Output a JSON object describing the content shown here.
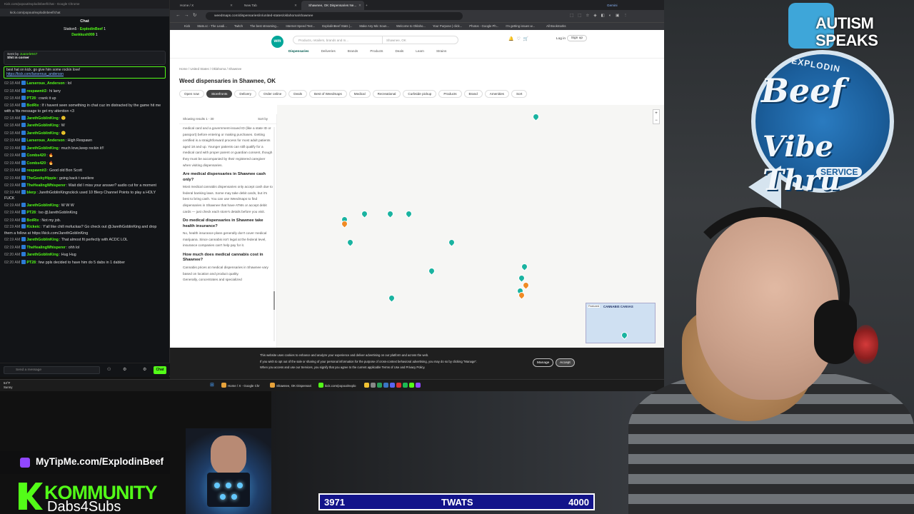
{
  "chat": {
    "window_title": "Kick.com/popout/explodinbeef/chat - Google Chrome",
    "url": "kick.com/popout/explodinbeef/chat",
    "header": "Chat",
    "top_gifters": [
      {
        "name": "Station5",
        "user": "ExplodinBeef",
        "count": "1"
      },
      {
        "name": "Dankkush999",
        "count": "1"
      }
    ],
    "pinned": {
      "by_label": "Sent by",
      "by_user": "Juanele947",
      "text": "Shit in corner"
    },
    "highlight": {
      "text": "best hat on kick. go give him some rockin love!",
      "link": "https://kick.com/larserous_anderson"
    },
    "messages": [
      {
        "time": "02:18 AM",
        "user": "Larserous_Anderson",
        "text": "lol"
      },
      {
        "time": "02:18 AM",
        "user": "respawnit3",
        "text": "hi larry"
      },
      {
        "time": "02:18 AM",
        "user": "PT28",
        "text": "crank it up"
      },
      {
        "time": "02:18 AM",
        "user": "BotRix",
        "text": "If i havent seen something in chat cuz im distracted by the game hit me with a !tts message to get my attention <3"
      },
      {
        "time": "02:18 AM",
        "user": "JarethGoblinKing",
        "text": "🙂"
      },
      {
        "time": "02:18 AM",
        "user": "JarethGoblinKing",
        "text": "W"
      },
      {
        "time": "02:18 AM",
        "user": "JarethGoblinKing",
        "text": "🙂"
      },
      {
        "time": "02:19 AM",
        "user": "Larserous_Anderson",
        "text": "High Respawn"
      },
      {
        "time": "02:19 AM",
        "user": "JarethGoblinKing",
        "text": "much love,keep rockin it!!"
      },
      {
        "time": "02:19 AM",
        "user": "Combs420",
        "text": "🔥"
      },
      {
        "time": "02:19 AM",
        "user": "Combs420",
        "text": "🔥"
      },
      {
        "time": "02:19 AM",
        "user": "respawnit3",
        "text": "Good old Bon Scott"
      },
      {
        "time": "02:19 AM",
        "user": "TheGeekyHippie",
        "text": "going back t seeilere"
      },
      {
        "time": "02:19 AM",
        "user": "TheHealingWhisperer",
        "text": "Wait did I miss your answer? audio cut for a moment"
      },
      {
        "time": "02:19 AM",
        "user": "blerp",
        "text": "JarethGoblinKingnckick used 10 Blerp Channel Points to play a HOLY FUCK"
      },
      {
        "time": "02:19 AM",
        "user": "JarethGoblinKing",
        "text": "W W W"
      },
      {
        "time": "02:19 AM",
        "user": "PT28",
        "text": "lso @JarethGoblinKing"
      },
      {
        "time": "02:19 AM",
        "user": "BotRix",
        "text": "Not my job."
      },
      {
        "time": "02:19 AM",
        "user": "Kickeic",
        "text": "Y'all like chill mofuckas? Go check out @JarethGoblinKing and drop them a follow at https://kick.com/JarethGoblinKing"
      },
      {
        "time": "02:19 AM",
        "user": "JarethGoblinKing",
        "text": "That almost fit perfectly with ACDC LOL"
      },
      {
        "time": "02:19 AM",
        "user": "TheHealingWhisperer",
        "text": "ohh lol"
      },
      {
        "time": "02:20 AM",
        "user": "JarethGoblinKing",
        "text": "Hug Hug"
      },
      {
        "time": "02:20 AM",
        "user": "PT28",
        "text": "few ppls decided to have him do 5 dabs in 1 dabber"
      }
    ],
    "input_placeholder": "Send a message",
    "send_label": "Chat"
  },
  "browser": {
    "tabs": [
      {
        "label": "Home / X"
      },
      {
        "label": "New Tab"
      },
      {
        "label": "Shawnee, OK Dispensaries Ne..."
      }
    ],
    "gemini_label": "Gemini",
    "url": "weedmaps.com/dispensaries/in/united-states/oklahoma/shawnee",
    "bookmarks": [
      "Kick",
      "Stats.cc - The Leadi...",
      "Twitch",
      "The best streaming...",
      "Internet Speed Test...",
      "ExplodinBeef Stats |...",
      "Make Any Mic Soun...",
      "Welcome to Oklaho...",
      "Your Purpose | click...",
      "Photos - Google Ph...",
      "I'm getting issues w..."
    ],
    "all_bookmarks": "All Bookmarks"
  },
  "weedmaps": {
    "logo": "wm",
    "search_placeholder": "Products, retailers, brands and m...",
    "location": "Shawnee, OK",
    "nav": [
      "Dispensaries",
      "Deliveries",
      "Brands",
      "Products",
      "Deals",
      "Learn",
      "Strains"
    ],
    "login": "Log in",
    "signup": "Sign up",
    "breadcrumb": "Home / United States / Oklahoma / Shawnee",
    "title": "Weed dispensaries in Shawnee, OK",
    "filters": [
      "Open now",
      "Storefronts",
      "Delivery",
      "Order online",
      "Deals",
      "Best of Weedmaps",
      "Medical",
      "Recreational",
      "Curbside pickup",
      "Products",
      "Brand",
      "Amenities",
      "Sort"
    ],
    "showing": "Showing results 1 - 30",
    "sort_by": "Sort by",
    "faq_intro": "medical card and a government-issued ID (like a state ID or passport) before entering or making purchases. Getting certified is a straightforward process for most adult patients aged 18 and up. Younger patients can still qualify for a medical card with proper parent or guardian consent, though they must be accompanied by their registered caregiver when visiting dispensaries.",
    "faqs": [
      {
        "q": "Are medical dispensaries in Shawnee cash only?",
        "a": "Most medical cannabis dispensaries only accept cash due to federal banking laws. Some may take debit cards, but it's best to bring cash. You can use Weedmaps to find dispensaries in Shawnee that have ATMs or accept debit cards — just check each store's details before you visit."
      },
      {
        "q": "Do medical dispensaries in Shawnee take health insurance?",
        "a": "No, health insurance plans generally don't cover medical marijuana. Since cannabis isn't legal at the federal level, insurance companies can't help pay for it."
      },
      {
        "q": "How much does medical cannabis cost in Shawnee?",
        "a": "Cannabis prices at medical dispensaries in Shawnee vary based on location and product quality."
      },
      {
        "q": "",
        "a": "Generally, concentrates and specialized"
      }
    ],
    "ad_label": "Featured",
    "ad_text": "CANNABIS CANVAS",
    "cookie_text_1": "This website uses cookies to enhance and analyze your experience and deliver advertising on our platform and across the web.",
    "cookie_text_2": "If you wish to opt out of the sale or sharing of your personal information for the purpose of cross-context behavioral advertising, you may do so by clicking \"Manage\".",
    "cookie_text_3": "When you access and use our Services, you signify that you agree to the current applicable Terms of Use and Privacy Policy.",
    "manage": "Manage",
    "accept": "Accept"
  },
  "taskbar": {
    "weather_temp": "54°F",
    "weather_desc": "Sunny",
    "items": [
      "Home / X - Google Chr",
      "Shawnee, OK Dispensari",
      "kick.com/popout/explo"
    ]
  },
  "overlays": {
    "autism_line1": "AUTISM",
    "autism_line2": "SPEAKS",
    "badge_top": "EXPLODIN",
    "badge_main": "Beef",
    "badge_sub": "Vibe Thru",
    "badge_service": "SERVICE",
    "mytip": "MyTipMe.com/ExplodinBeef",
    "kommunity_1": "KOMMUNITY",
    "kommunity_2": "Dabs4Subs",
    "goal_current": "3971",
    "goal_label": "TWATS",
    "goal_target": "4000"
  },
  "colors": {
    "kick_green": "#53fc18",
    "weedmaps_teal": "#00a699",
    "goal_blue": "#13148a"
  }
}
